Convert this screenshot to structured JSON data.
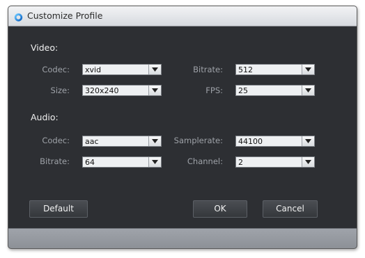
{
  "window": {
    "title": "Customize Profile"
  },
  "video": {
    "section_title": "Video:",
    "codec": {
      "label": "Codec:",
      "value": "xvid"
    },
    "size": {
      "label": "Size:",
      "value": "320x240"
    },
    "bitrate": {
      "label": "Bitrate:",
      "value": "512"
    },
    "fps": {
      "label": "FPS:",
      "value": "25"
    }
  },
  "audio": {
    "section_title": "Audio:",
    "codec": {
      "label": "Codec:",
      "value": "aac"
    },
    "bitrate": {
      "label": "Bitrate:",
      "value": "64"
    },
    "samplerate": {
      "label": "Samplerate:",
      "value": "44100"
    },
    "channel": {
      "label": "Channel:",
      "value": "2"
    }
  },
  "buttons": {
    "default_label": "Default",
    "ok_label": "OK",
    "cancel_label": "Cancel"
  },
  "icons": {
    "app": "app-logo-icon",
    "dropdown": "chevron-down-icon"
  },
  "colors": {
    "panel_bg": "#2d2f33",
    "label_text": "#9ea2a8",
    "section_text": "#f0f0f0"
  }
}
